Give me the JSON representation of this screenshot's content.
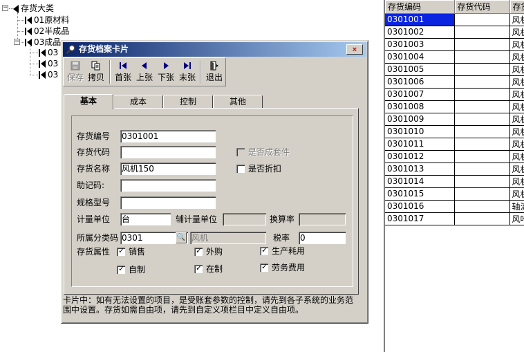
{
  "tree": {
    "root": "存货大类",
    "nodes": [
      "01原材料",
      "02半成品",
      "03成品"
    ],
    "partial": [
      "03",
      "03",
      "03"
    ]
  },
  "grid": {
    "headers": [
      "存货编码",
      "存货代码",
      "存货"
    ],
    "rows": [
      [
        "0301001",
        "",
        "风机"
      ],
      [
        "0301002",
        "",
        "风机"
      ],
      [
        "0301003",
        "",
        "风机"
      ],
      [
        "0301004",
        "",
        "风机"
      ],
      [
        "0301005",
        "",
        "风机"
      ],
      [
        "0301006",
        "",
        "风机"
      ],
      [
        "0301007",
        "",
        "风机"
      ],
      [
        "0301008",
        "",
        "风机"
      ],
      [
        "0301009",
        "",
        "风机"
      ],
      [
        "0301010",
        "",
        "风机"
      ],
      [
        "0301011",
        "",
        "风机"
      ],
      [
        "0301012",
        "",
        "风机"
      ],
      [
        "0301013",
        "",
        "风机"
      ],
      [
        "0301014",
        "",
        "风机"
      ],
      [
        "0301015",
        "",
        "风机"
      ],
      [
        "0301016",
        "",
        "轴流"
      ],
      [
        "0301017",
        "",
        "风叶"
      ]
    ],
    "selected_row": 0
  },
  "dialog": {
    "title": "存货档案卡片",
    "close_symbol": "×",
    "toolbar": {
      "save": "保存",
      "copy": "拷贝",
      "first": "首张",
      "prev": "上张",
      "next": "下张",
      "last": "末张",
      "exit": "退出"
    },
    "tabs": [
      "基本",
      "成本",
      "控制",
      "其他"
    ],
    "form": {
      "code_label": "存货编号",
      "code_value": "0301001",
      "dm_label": "存货代码",
      "dm_value": "",
      "name_label": "存货名称",
      "name_value": "风机150",
      "mnemonic_label": "助记码:",
      "mnemonic_value": "",
      "spec_label": "规格型号",
      "spec_value": "",
      "unit_label": "计量单位",
      "unit_value": "台",
      "aux_unit_label": "辅计量单位",
      "aux_unit_value": "",
      "rate_label": "换算率",
      "rate_value": "",
      "class_label": "所属分类码",
      "class_value": "0301",
      "class_name": "风机",
      "tax_label": "税率",
      "tax_value": "0",
      "attr_label": "存货属性",
      "kit_label": "是否成套件",
      "discount_label": "是否折扣",
      "sale_label": "销售",
      "purchase_label": "外购",
      "production_label": "生产耗用",
      "self_made_label": "自制",
      "wip_label": "在制",
      "service_label": "劳务费用",
      "check_mark": "✓",
      "lookup_symbol": "🔍"
    },
    "note": "卡片中：如有无法设置的项目，是受账套参数的控制，请先到各子系统的业务范\n围中设置。存货如需自由项，请先到自定义项栏目中定义自由项。"
  }
}
